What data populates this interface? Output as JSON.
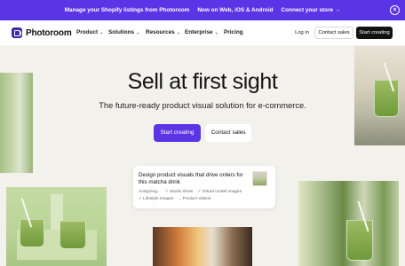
{
  "banner": {
    "message": "Manage your Shopify listings from Photoroom",
    "platforms": "Now on Web, iOS & Android",
    "cta": "Connect your store →",
    "close_icon": "close-icon"
  },
  "nav": {
    "brand": "Photoroom",
    "items": [
      {
        "label": "Product",
        "has_caret": true
      },
      {
        "label": "Solutions",
        "has_caret": true
      },
      {
        "label": "Resources",
        "has_caret": true
      },
      {
        "label": "Enterprise",
        "has_caret": true
      },
      {
        "label": "Pricing",
        "has_caret": false
      }
    ],
    "login": "Log in",
    "contact": "Contact sales",
    "start": "Start creating"
  },
  "hero": {
    "headline": "Sell at first sight",
    "subhead": "The future-ready product visual solution for e-commerce.",
    "primary_cta": "Start creating",
    "secondary_cta": "Contact sales"
  },
  "card": {
    "prompt": "Design product visuals that drive orders for this matcha drink",
    "status": "Analyzing...",
    "tasks": [
      "Studio shots",
      "Virtual model images",
      "Lifestyle images",
      "Product videos"
    ]
  },
  "colors": {
    "accent": "#5b34e6",
    "background": "#f3f1ec",
    "dark_button": "#121212"
  }
}
